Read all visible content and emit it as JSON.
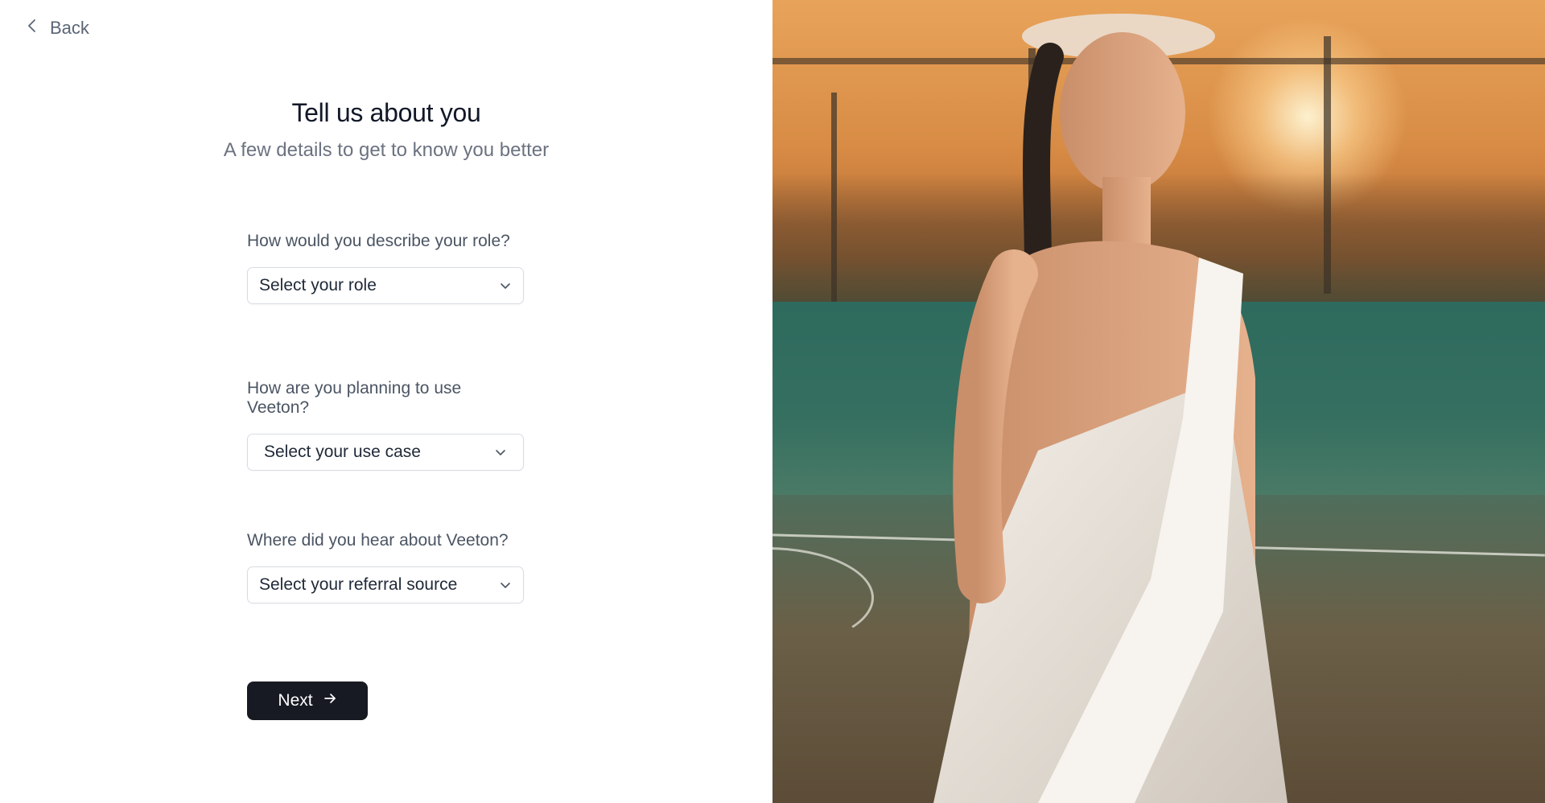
{
  "nav": {
    "back_label": "Back"
  },
  "header": {
    "title": "Tell us about you",
    "subtitle": "A few details to get to know you better"
  },
  "form": {
    "fields": [
      {
        "label": "How would you describe your role?",
        "selected_value": "Select your role"
      },
      {
        "label": "How are you planning to use Veeton?",
        "selected_value": "Select your use case"
      },
      {
        "label": "Where did you hear about Veeton?",
        "selected_value": "Select your referral source"
      }
    ],
    "next_label": "Next"
  },
  "icons": {
    "back": "chevron-left-icon",
    "select": "chevron-down-icon",
    "next": "arrow-right-icon"
  },
  "colors": {
    "primary_button": "#171a22",
    "title": "#111827",
    "muted_text": "#6b7280",
    "border": "#d8dde4"
  }
}
